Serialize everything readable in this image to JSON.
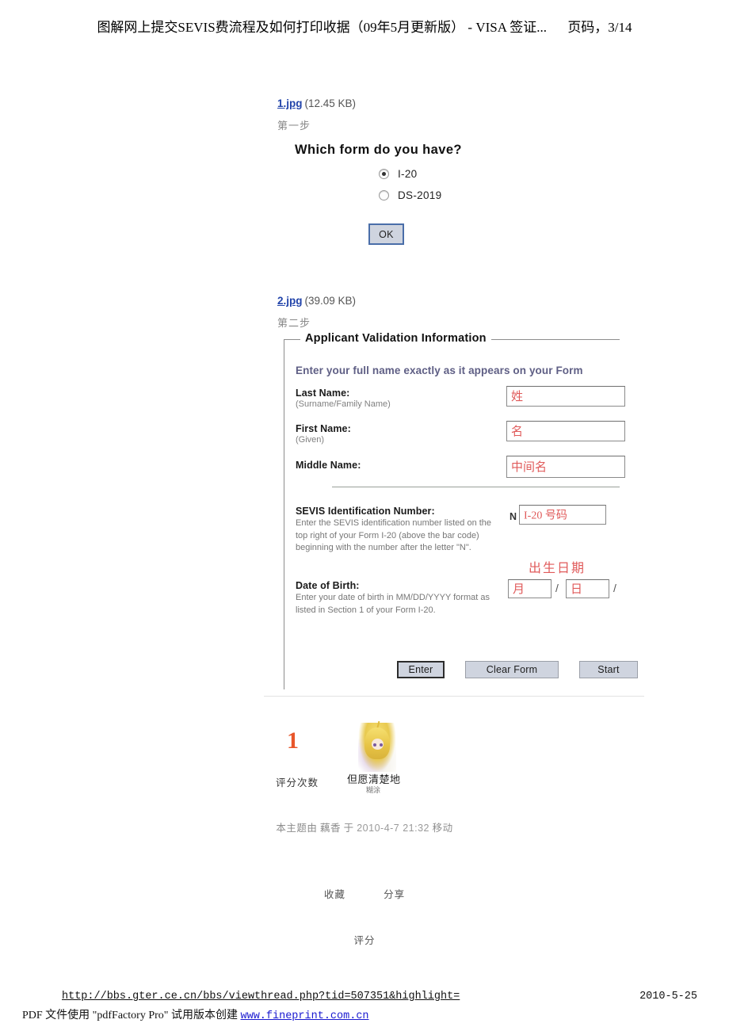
{
  "header": {
    "title": "图解网上提交SEVIS费流程及如何打印收据（09年5月更新版） - VISA 签证...",
    "page_label": "页码，3/14"
  },
  "attachments": [
    {
      "filename": "1.jpg",
      "size": "(12.45 KB)",
      "step": "第一步"
    },
    {
      "filename": "2.jpg",
      "size": "(39.09 KB)",
      "step": "第二步"
    }
  ],
  "form_which": {
    "question": "Which form do you have?",
    "options": [
      {
        "label": "I-20",
        "selected": true
      },
      {
        "label": "DS-2019",
        "selected": false
      }
    ],
    "ok_button": "OK"
  },
  "form_validation": {
    "legend": "Applicant Validation Information",
    "intro": "Enter your full name exactly as it appears on your Form",
    "fields": {
      "last_name": {
        "label": "Last Name:",
        "sub": "(Surname/Family Name)",
        "annotation": "姓"
      },
      "first_name": {
        "label": "First Name:",
        "sub": "(Given)",
        "annotation": "名"
      },
      "middle_name": {
        "label": "Middle Name:",
        "sub": "",
        "annotation": "中间名"
      },
      "sevis_id": {
        "label": "SEVIS Identification Number:",
        "desc": "Enter the SEVIS identification number listed on the top right of your Form I-20 (above the bar code) beginning with the number after the letter \"N\".",
        "prefix": "N",
        "annotation": "I-20 号码"
      },
      "date_of_birth": {
        "label": "Date of Birth:",
        "desc": "Enter your date of birth in MM/DD/YYYY format as listed in Section 1 of your Form I-20.",
        "annotation_title": "出生日期",
        "month": "月",
        "day": "日",
        "separator": "/"
      }
    },
    "buttons": [
      {
        "label": "Enter",
        "focused": true
      },
      {
        "label": "Clear Form",
        "focused": false
      },
      {
        "label": "Start",
        "focused": false
      }
    ]
  },
  "rating": {
    "count": "1",
    "count_label": "评分次数",
    "author_name": "但愿清楚地",
    "author_sub": "糊涂"
  },
  "moved_note": {
    "prefix": "本主题由 藕香 于",
    "datetime": "2010-4-7 21:32",
    "suffix": "移动"
  },
  "actions": {
    "favorite": "收藏",
    "share": "分享",
    "rate": "评分"
  },
  "footer": {
    "url": "http://bbs.gter.ce.cn/bbs/viewthread.php?tid=507351&highlight=",
    "date": "2010-5-25",
    "watermark_text": "PDF 文件使用 \"pdfFactory Pro\" 试用版本创建",
    "watermark_link": "www.fineprint.com.cn"
  },
  "colors": {
    "link": "#2244aa",
    "annotation_red": "#e05a5a",
    "rating_orange": "#e8562a",
    "button_face": "#cfd4df",
    "intro_purple": "#5f5f85"
  }
}
